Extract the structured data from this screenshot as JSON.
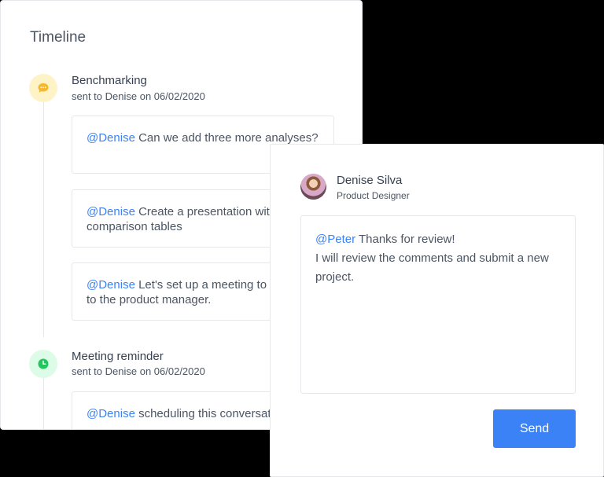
{
  "timeline": {
    "title": "Timeline",
    "events": [
      {
        "icon": "chat-bubble-icon",
        "title": "Benchmarking",
        "subtitle": "sent to Denise on 06/02/2020",
        "messages": [
          {
            "mention": "@Denise",
            "text": " Can we add three more analyses?"
          },
          {
            "mention": "@Denise",
            "text": " Create a presentation with comparison tables"
          },
          {
            "mention": "@Denise",
            "text": " Let's set up a meeting to present to the product manager."
          }
        ]
      },
      {
        "icon": "clock-icon",
        "title": "Meeting reminder",
        "subtitle": "sent to Denise on 06/02/2020",
        "messages": [
          {
            "mention": "@Denise",
            "text": " scheduling this conversation"
          }
        ]
      }
    ]
  },
  "reply": {
    "user_name": "Denise Silva",
    "user_role": "Product Designer",
    "message_mention": "@Peter",
    "message_line1": " Thanks for review!",
    "message_rest": "I will review the comments and submit a new project.",
    "send_label": "Send"
  },
  "colors": {
    "accent": "#3b82f6",
    "mention": "#3b82f6",
    "chat_icon": "#f5b82e",
    "clock_icon": "#22c55e"
  }
}
